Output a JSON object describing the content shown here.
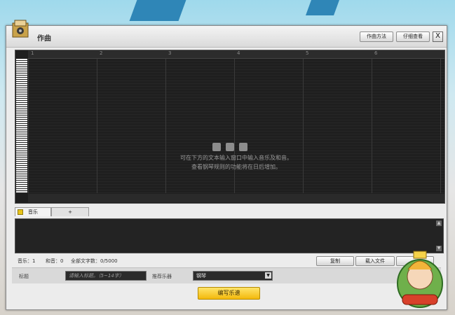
{
  "window": {
    "title": "作曲"
  },
  "header_buttons": {
    "method": "作曲方法",
    "detail": "仔细查看",
    "close": "X"
  },
  "ruler": [
    "1",
    "2",
    "3",
    "4",
    "5",
    "6"
  ],
  "hint": {
    "line1": "可在下方的文本输入窗口中输入音乐及和音。",
    "line2": "查看钢琴规则的功能将在日后增加。"
  },
  "tabs": [
    {
      "label": "音乐",
      "active": true
    },
    {
      "label": "+",
      "active": false
    }
  ],
  "stats": {
    "melody": "音乐：1",
    "chord": "和音：0",
    "total": "全部文字数：0/5000"
  },
  "side_buttons": {
    "copy": "复制",
    "load": "载入文件",
    "extra": ""
  },
  "fields": {
    "title_label": "标题",
    "title_placeholder": "请输入标题。（5~14字）",
    "instrument_label": "推荐乐器",
    "instrument_value": "钢琴"
  },
  "compose_button": "编写乐谱",
  "accent": {
    "yellow": "#f3b90b",
    "dark": "#1f1f1f"
  },
  "icons": [
    "box-icon",
    "piano-keys-icon",
    "loading-dots-icon",
    "scroll-up-icon",
    "scroll-down-icon",
    "dropdown-arrow-icon",
    "mascot-badge-icon"
  ]
}
